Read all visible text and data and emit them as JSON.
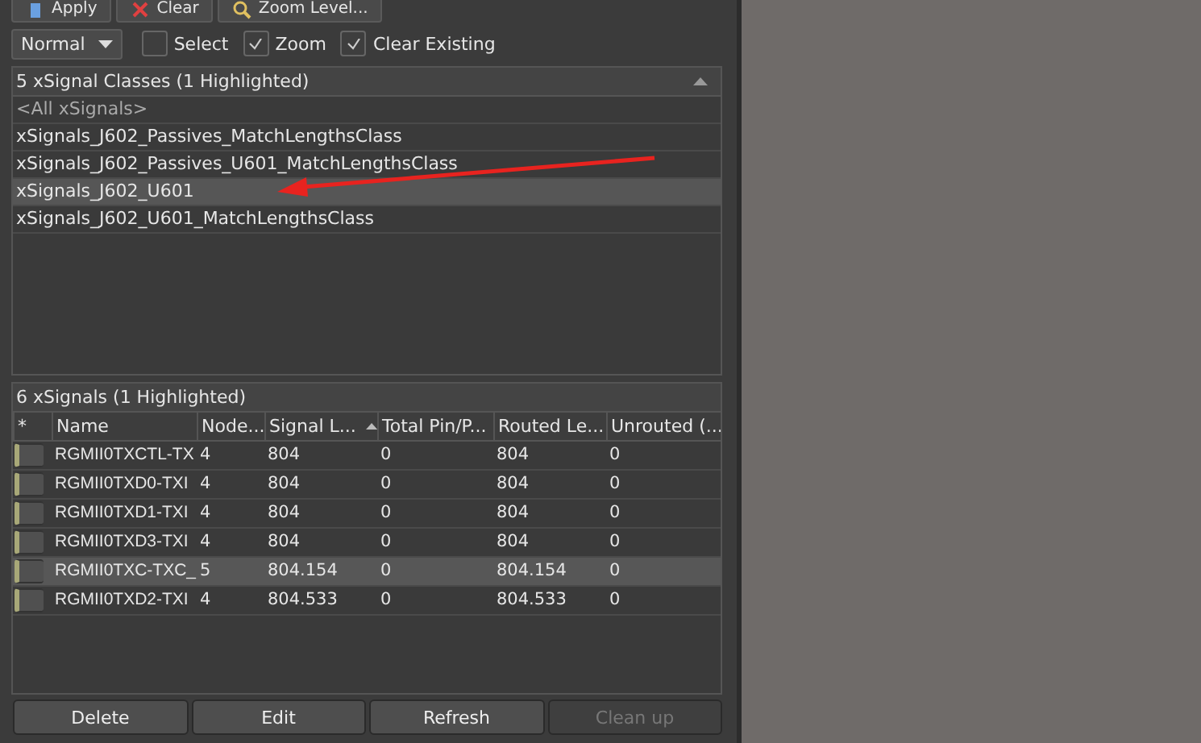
{
  "toolbar": {
    "buttons": [
      {
        "label": "Apply",
        "kind": "apply"
      },
      {
        "label": "Clear",
        "kind": "clear"
      },
      {
        "label": "Zoom Level...",
        "kind": "zoom"
      }
    ]
  },
  "options": {
    "mode": "Normal",
    "checkboxes": [
      {
        "label": "Select",
        "checked": false
      },
      {
        "label": "Zoom",
        "checked": true
      },
      {
        "label": "Clear Existing",
        "checked": true
      }
    ]
  },
  "classes": {
    "header": "5 xSignal Classes (1 Highlighted)",
    "items": [
      {
        "label": "<All xSignals>",
        "kind": "all",
        "selected": false
      },
      {
        "label": "xSignals_J602_Passives_MatchLengthsClass",
        "kind": "class",
        "selected": false
      },
      {
        "label": "xSignals_J602_Passives_U601_MatchLengthsClass",
        "kind": "class",
        "selected": false
      },
      {
        "label": "xSignals_J602_U601",
        "kind": "class",
        "selected": true
      },
      {
        "label": "xSignals_J602_U601_MatchLengthsClass",
        "kind": "class",
        "selected": false
      }
    ]
  },
  "signals": {
    "header": "6 xSignals (1 Highlighted)",
    "marker_column": "*",
    "columns": [
      "Name",
      "Node...",
      "Signal L...",
      "Total Pin/P...",
      "Routed Le...",
      "Unrouted (..."
    ],
    "rows": [
      {
        "selected": false,
        "cells": [
          "RGMII0TXCTL-TX",
          "4",
          "804",
          "0",
          "804",
          "0"
        ]
      },
      {
        "selected": false,
        "cells": [
          "RGMII0TXD0-TXI",
          "4",
          "804",
          "0",
          "804",
          "0"
        ]
      },
      {
        "selected": false,
        "cells": [
          "RGMII0TXD1-TXI",
          "4",
          "804",
          "0",
          "804",
          "0"
        ]
      },
      {
        "selected": false,
        "cells": [
          "RGMII0TXD3-TXI",
          "4",
          "804",
          "0",
          "804",
          "0"
        ]
      },
      {
        "selected": true,
        "cells": [
          "RGMII0TXC-TXC_",
          "5",
          "804.154",
          "0",
          "804.154",
          "0"
        ]
      },
      {
        "selected": false,
        "cells": [
          "RGMII0TXD2-TXI",
          "4",
          "804.533",
          "0",
          "804.533",
          "0"
        ]
      }
    ]
  },
  "actions": [
    {
      "label": "Delete",
      "disabled": false
    },
    {
      "label": "Edit",
      "disabled": false
    },
    {
      "label": "Refresh",
      "disabled": false
    },
    {
      "label": "Clean up",
      "disabled": true
    }
  ]
}
